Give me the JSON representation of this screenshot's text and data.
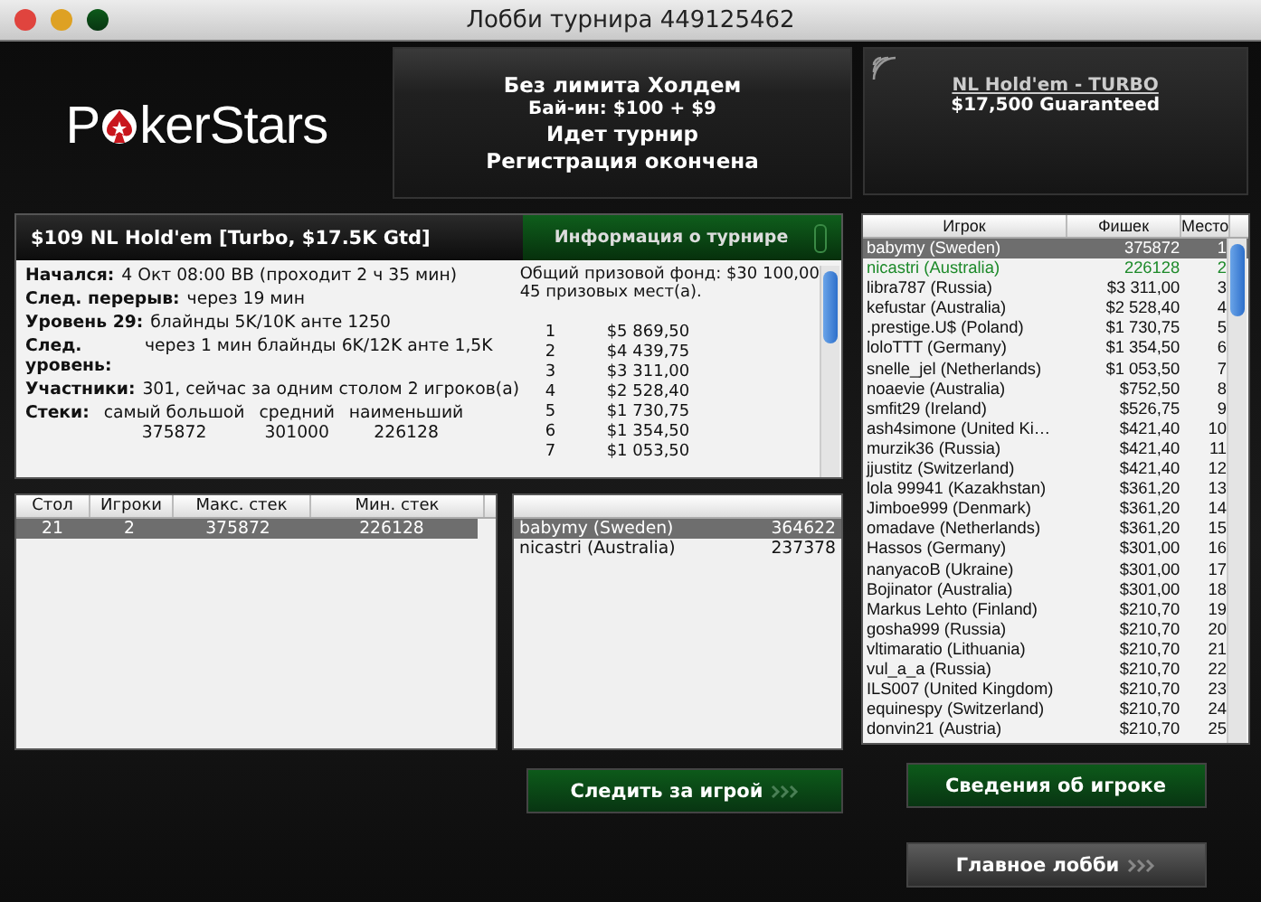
{
  "window": {
    "title": "Лобби турнира 449125462"
  },
  "logo": {
    "lead": "P",
    "tail": "kerStars"
  },
  "summary": {
    "lines": [
      "Без лимита Холдем",
      "Бай-ин: $100 + $9",
      "Идет турнир",
      "Регистрация окончена"
    ]
  },
  "promo": {
    "link": "NL Hold'em - TURBO",
    "subtitle": "$17,500 Guaranteed"
  },
  "info_panel": {
    "title": "$109 NL Hold'em [Turbo, $17.5K Gtd]",
    "tab": "Информация о турнире",
    "stats": [
      {
        "label": "Начался:",
        "value": "4 Окт 08:00 BB (проходит 2 ч 35 мин)"
      },
      {
        "label": "След. перерыв:",
        "value": "через 19 мин"
      },
      {
        "label": "Уровень 29:",
        "value": "блайнды 5K/10K анте 1250"
      },
      {
        "label": "След. уровень:",
        "value": "через 1 мин блайнды 6K/12K анте 1,5K"
      },
      {
        "label": "Участники:",
        "value": "301, сейчас за одним столом 2 игроков(а)"
      }
    ],
    "stacks": {
      "label": "Стеки:",
      "columns": [
        {
          "heading": "самый большой",
          "value": "375872"
        },
        {
          "heading": "средний",
          "value": "301000"
        },
        {
          "heading": "наименьший",
          "value": "226128"
        }
      ]
    },
    "prize_pool": "Общий призовой фонд: $30 100,00",
    "paid_places": "45 призовых мест(а).",
    "prizes": [
      {
        "place": "1",
        "amount": "$5 869,50"
      },
      {
        "place": "2",
        "amount": "$4 439,75"
      },
      {
        "place": "3",
        "amount": "$3 311,00"
      },
      {
        "place": "4",
        "amount": "$2 528,40"
      },
      {
        "place": "5",
        "amount": "$1 730,75"
      },
      {
        "place": "6",
        "amount": "$1 354,50"
      },
      {
        "place": "7",
        "amount": "$1 053,50"
      }
    ]
  },
  "tables": {
    "columns": [
      "Стол",
      "Игроки",
      "Макс. стек",
      "Мин. стек"
    ],
    "rows": [
      {
        "cells": [
          "21",
          "2",
          "375872",
          "226128"
        ],
        "selected": true
      }
    ]
  },
  "table_players": {
    "rows": [
      {
        "name": "babymy (Sweden)",
        "chips": "364622",
        "selected": true
      },
      {
        "name": "nicastri (Australia)",
        "chips": "237378",
        "selected": false
      }
    ]
  },
  "players": {
    "columns": [
      "Игрок",
      "Фишек",
      "Место"
    ],
    "rows": [
      {
        "name": "babymy (Sweden)",
        "chips": "375872",
        "place": "1",
        "selected": true,
        "highlighted": false
      },
      {
        "name": "nicastri (Australia)",
        "chips": "226128",
        "place": "2",
        "selected": false,
        "highlighted": true
      },
      {
        "name": "libra787 (Russia)",
        "chips": "$3 311,00",
        "place": "3",
        "selected": false,
        "highlighted": false
      },
      {
        "name": "kefustar (Australia)",
        "chips": "$2 528,40",
        "place": "4",
        "selected": false,
        "highlighted": false
      },
      {
        "name": ".prestige.U$ (Poland)",
        "chips": "$1 730,75",
        "place": "5",
        "selected": false,
        "highlighted": false
      },
      {
        "name": "loloTTT (Germany)",
        "chips": "$1 354,50",
        "place": "6",
        "selected": false,
        "highlighted": false
      },
      {
        "name": "snelle_jel (Netherlands)",
        "chips": "$1 053,50",
        "place": "7",
        "selected": false,
        "highlighted": false
      },
      {
        "name": "noaevie (Australia)",
        "chips": "$752,50",
        "place": "8",
        "selected": false,
        "highlighted": false
      },
      {
        "name": "smfit29 (Ireland)",
        "chips": "$526,75",
        "place": "9",
        "selected": false,
        "highlighted": false
      },
      {
        "name": "ash4simone (United Ki…",
        "chips": "$421,40",
        "place": "10",
        "selected": false,
        "highlighted": false
      },
      {
        "name": "murzik36 (Russia)",
        "chips": "$421,40",
        "place": "11",
        "selected": false,
        "highlighted": false
      },
      {
        "name": "jjustitz (Switzerland)",
        "chips": "$421,40",
        "place": "12",
        "selected": false,
        "highlighted": false
      },
      {
        "name": "lola 99941 (Kazakhstan)",
        "chips": "$361,20",
        "place": "13",
        "selected": false,
        "highlighted": false
      },
      {
        "name": "Jimboe999 (Denmark)",
        "chips": "$361,20",
        "place": "14",
        "selected": false,
        "highlighted": false
      },
      {
        "name": "omadave (Netherlands)",
        "chips": "$361,20",
        "place": "15",
        "selected": false,
        "highlighted": false
      },
      {
        "name": "Hassos (Germany)",
        "chips": "$301,00",
        "place": "16",
        "selected": false,
        "highlighted": false
      },
      {
        "name": "nanyacoB (Ukraine)",
        "chips": "$301,00",
        "place": "17",
        "selected": false,
        "highlighted": false
      },
      {
        "name": "Bojinator (Australia)",
        "chips": "$301,00",
        "place": "18",
        "selected": false,
        "highlighted": false
      },
      {
        "name": "Markus Lehto (Finland)",
        "chips": "$210,70",
        "place": "19",
        "selected": false,
        "highlighted": false
      },
      {
        "name": "gosha999 (Russia)",
        "chips": "$210,70",
        "place": "20",
        "selected": false,
        "highlighted": false
      },
      {
        "name": "vltimaratio (Lithuania)",
        "chips": "$210,70",
        "place": "21",
        "selected": false,
        "highlighted": false
      },
      {
        "name": "vul_a_a (Russia)",
        "chips": "$210,70",
        "place": "22",
        "selected": false,
        "highlighted": false
      },
      {
        "name": "ILS007 (United Kingdom)",
        "chips": "$210,70",
        "place": "23",
        "selected": false,
        "highlighted": false
      },
      {
        "name": "equinespy (Switzerland)",
        "chips": "$210,70",
        "place": "24",
        "selected": false,
        "highlighted": false
      },
      {
        "name": "donvin21 (Austria)",
        "chips": "$210,70",
        "place": "25",
        "selected": false,
        "highlighted": false
      }
    ]
  },
  "buttons": {
    "watch": "Следить за игрой",
    "player_info": "Сведения об игроке",
    "main_lobby": "Главное лобби"
  }
}
